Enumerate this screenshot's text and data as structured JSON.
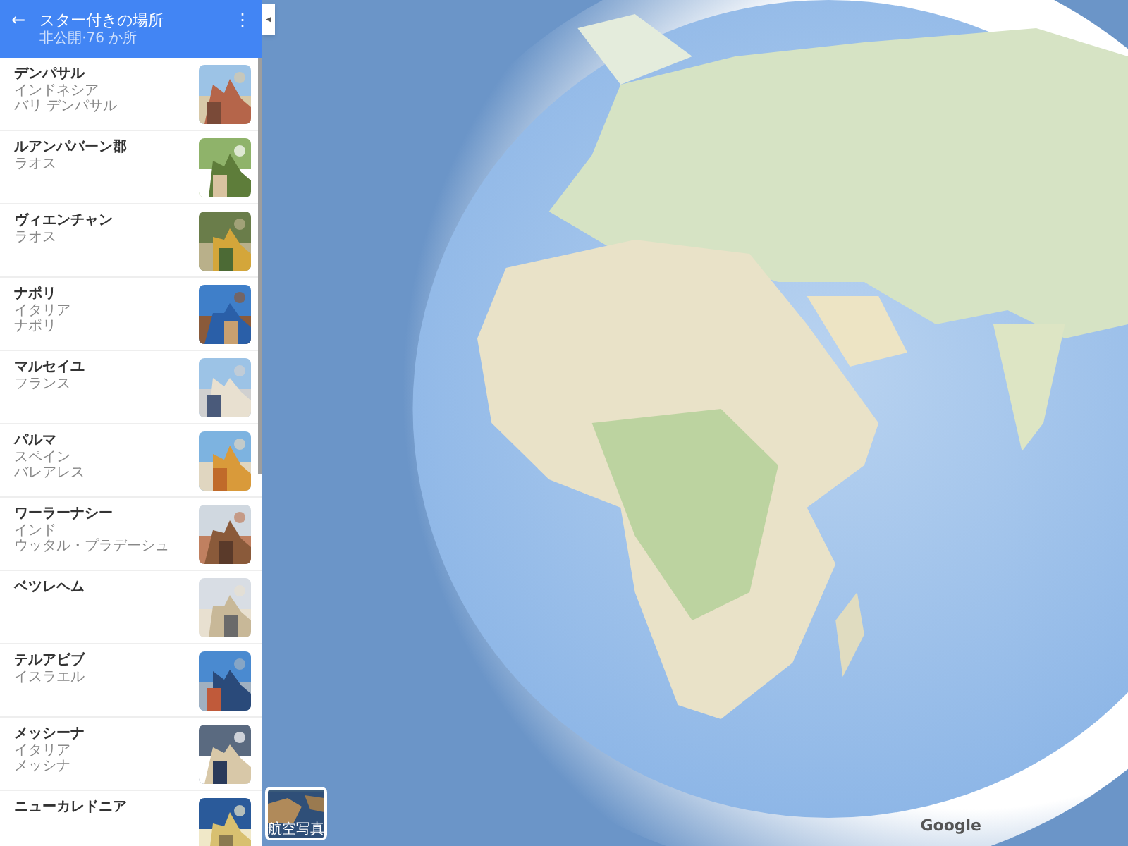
{
  "header": {
    "back_icon": "←",
    "title": "スター付きの場所",
    "subtitle": "非公開·76 か所",
    "menu_icon": "⋮"
  },
  "places": [
    {
      "name": "デンパサル",
      "details": [
        "インドネシア",
        "バリ デンパサル"
      ]
    },
    {
      "name": "ルアンパバーン郡",
      "details": [
        "ラオス"
      ]
    },
    {
      "name": "ヴィエンチャン",
      "details": [
        "ラオス"
      ]
    },
    {
      "name": "ナポリ",
      "details": [
        "イタリア",
        "ナポリ"
      ]
    },
    {
      "name": "マルセイユ",
      "details": [
        "フランス"
      ]
    },
    {
      "name": "パルマ",
      "details": [
        "スペイン",
        "バレアレス"
      ]
    },
    {
      "name": "ワーラーナシー",
      "details": [
        "インド",
        "ウッタル・プラデーシュ"
      ]
    },
    {
      "name": "ベツレヘム"
    },
    {
      "name": "テルアビブ",
      "details": [
        "イスラエル"
      ]
    },
    {
      "name": "メッシーナ",
      "details": [
        "イタリア",
        "メッシナ"
      ]
    },
    {
      "name": "ニューカレドニア"
    }
  ],
  "collapse_button": "◂",
  "layer_switcher": {
    "label": "航空写真"
  },
  "logo": "Google"
}
